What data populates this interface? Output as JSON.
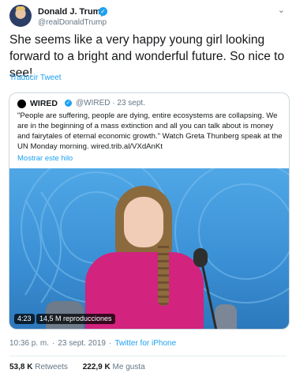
{
  "author": {
    "name": "Donald J. Trump",
    "handle": "@realDonaldTrump",
    "verified_icon": "verified-badge-icon"
  },
  "tweet": {
    "text": "She seems like a very happy young girl looking forward to a bright and wonderful future. So nice to see!",
    "translate_link": "Traducir Tweet"
  },
  "quoted": {
    "name": "WIRED",
    "handle": "@WIRED",
    "date": "23 sept.",
    "text": "\"People are suffering, people are dying, entire ecosystems are collapsing. We are in the beginning of a mass extinction and all you can talk about is money and fairytales of eternal economic growth.\" Watch Greta Thunberg speak at the UN Monday morning. wired.trib.al/VXdAnKt",
    "thread_link": "Mostrar este hilo",
    "video": {
      "duration": "4:23",
      "views": "14,5 M reproducciones"
    }
  },
  "meta": {
    "time": "10:36 p. m.",
    "separator": "·",
    "date": "23 sept. 2019",
    "source": "Twitter for iPhone"
  },
  "stats": {
    "retweets_count": "53,8 K",
    "retweets_label": "Retweets",
    "likes_count": "222,9 K",
    "likes_label": "Me gusta"
  },
  "colors": {
    "link": "#1da1f2",
    "secondary_text": "#657786",
    "accent_shirt": "#d2237e"
  }
}
